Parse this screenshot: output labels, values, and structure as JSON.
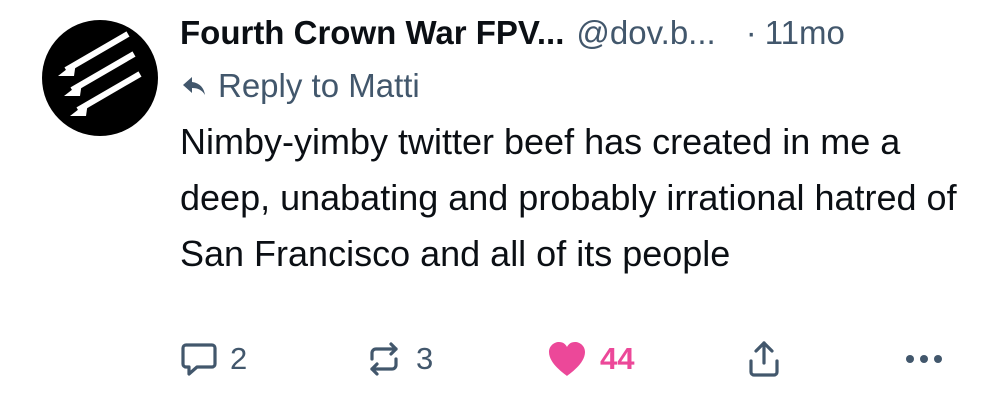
{
  "post": {
    "author_name": "Fourth Crown War FPV...",
    "author_handle": "@dov.b...",
    "separator": "·",
    "time": "11mo",
    "avatar_icon": "three-arrows-icon",
    "reply_prefix": "Reply to Matti",
    "reply_icon": "reply-arrow-icon",
    "text": "Nimby-yimby twitter beef has created in me a deep, unabating and probably irrational hatred of San Francisco and all of its people"
  },
  "actions": {
    "reply_count": "2",
    "repost_count": "3",
    "like_count": "44",
    "liked": true
  },
  "colors": {
    "text": "#0b0f14",
    "muted": "#42576c",
    "like": "#ec4899",
    "avatar_bg": "#000000"
  }
}
